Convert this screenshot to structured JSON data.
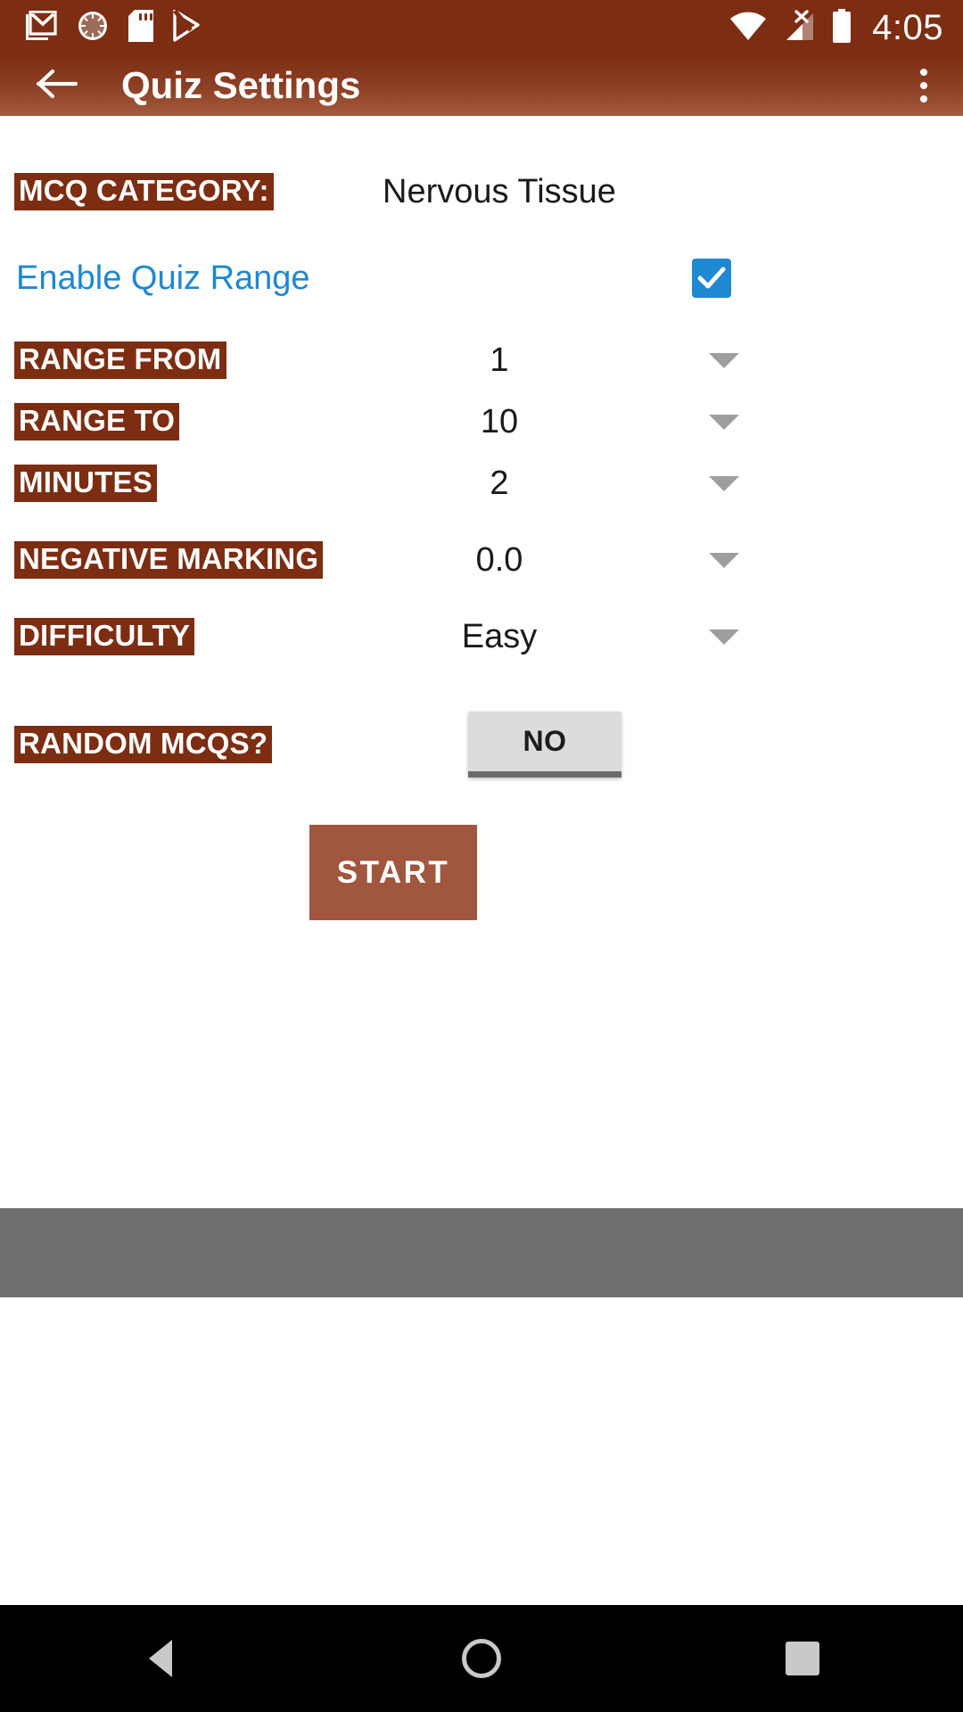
{
  "statusbar": {
    "time": "4:05",
    "icons_left": [
      "gmail-icon",
      "sync-progress-icon",
      "sd-card-icon",
      "play-store-icon"
    ],
    "icons_right": [
      "wifi-icon",
      "cellular-no-signal-icon",
      "battery-icon"
    ],
    "background_color": "#7c2d12"
  },
  "appbar": {
    "title": "Quiz Settings",
    "back_icon": "arrow-back-icon",
    "overflow_icon": "more-vert-icon",
    "background_color": "#7c2d12"
  },
  "settings": {
    "category": {
      "label": "MCQ CATEGORY:",
      "value": "Nervous Tissue"
    },
    "enable_range": {
      "label": "Enable Quiz Range",
      "checked": true,
      "link_color": "#1e88d2",
      "checkbox_color": "#1e88d2"
    },
    "range_from": {
      "label": "RANGE FROM",
      "value": "1",
      "caret": "chevron-down-icon"
    },
    "range_to": {
      "label": "RANGE TO",
      "value": "10",
      "caret": "chevron-down-icon"
    },
    "minutes": {
      "label": "MINUTES",
      "value": "2",
      "caret": "chevron-down-icon"
    },
    "negative_marking": {
      "label": "NEGATIVE MARKING",
      "value": "0.0",
      "caret": "chevron-down-icon"
    },
    "difficulty": {
      "label": "DIFFICULTY",
      "value": "Easy",
      "caret": "chevron-down-icon"
    },
    "random_mcqs": {
      "label": "RANDOM MCQS?",
      "value": "NO"
    },
    "start_button": {
      "label": "START",
      "color": "#a0563f"
    },
    "label_highlight_color": "#7c2d12"
  },
  "navbar": {
    "back": "navigation-back-icon",
    "home": "navigation-home-icon",
    "recents": "navigation-recents-icon"
  }
}
